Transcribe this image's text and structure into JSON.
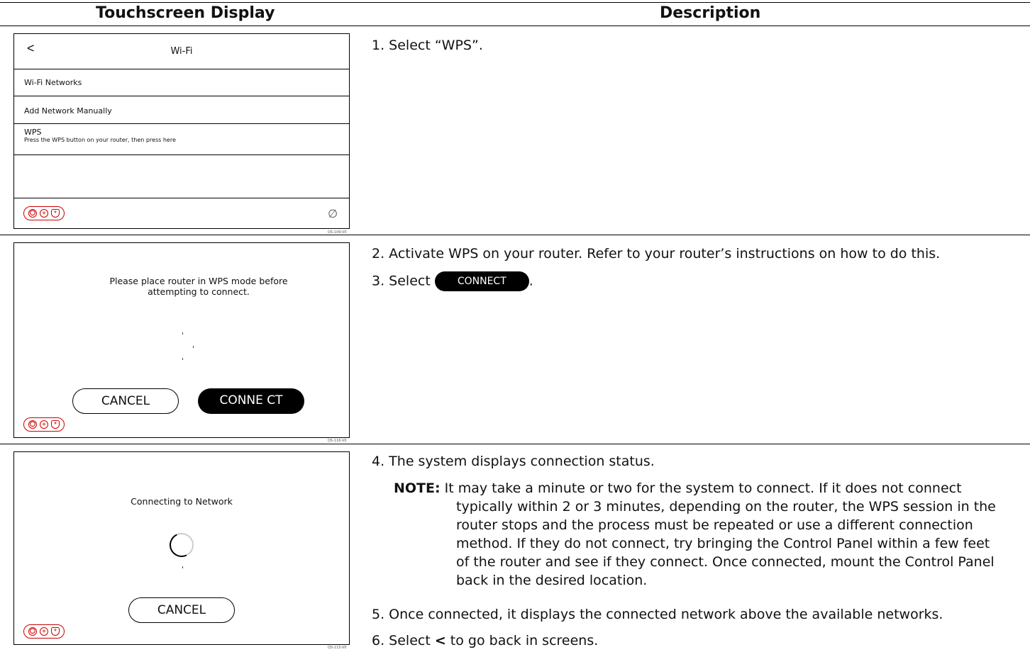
{
  "header": {
    "left": "Touchscreen Display",
    "right": "Description"
  },
  "screen1": {
    "back": "<",
    "title": "Wi-Fi",
    "rows": [
      {
        "label": "Wi-Fi Networks"
      },
      {
        "label": "Add Network Manually"
      },
      {
        "label": "WPS",
        "sub": "Press the WPS button on your router, then press here"
      }
    ],
    "code": "QS-109-V0"
  },
  "screen2": {
    "message": "Please place router in WPS mode before attempting to connect.",
    "cancel": "CANCEL",
    "connect": "CONNE CT",
    "code": "QS-116-V0"
  },
  "screen3": {
    "message": "Connecting to Network",
    "cancel": "CANCEL",
    "code": "QS-115-V0"
  },
  "steps": {
    "s1": "1.  Select “WPS”.",
    "s2": "2.  Activate WPS on your router.  Refer to your router’s instructions on how to do this.",
    "s3_prefix": "3.  Select",
    "s3_pill": "CONNECT",
    "s3_suffix": ".",
    "s4": "4.  The system displays connection status.",
    "note_label": "NOTE:",
    "note_text": " It may take a minute or two for the system to connect.  If it does not connect typically within 2 or 3 minutes, depending on the router, the WPS session in the router stops and the process must be repeated or use a different connection method.  If they do not connect, try bringing the Control Panel within a few feet of the router and see if they connect.  Once connected, mount the Control Panel back in the desired location.",
    "s5": "5.  Once connected, it displays the connected network above the available networks.",
    "s6_prefix": "6.  Select ",
    "s6_bold": "<",
    "s6_suffix": " to go back in screens."
  }
}
